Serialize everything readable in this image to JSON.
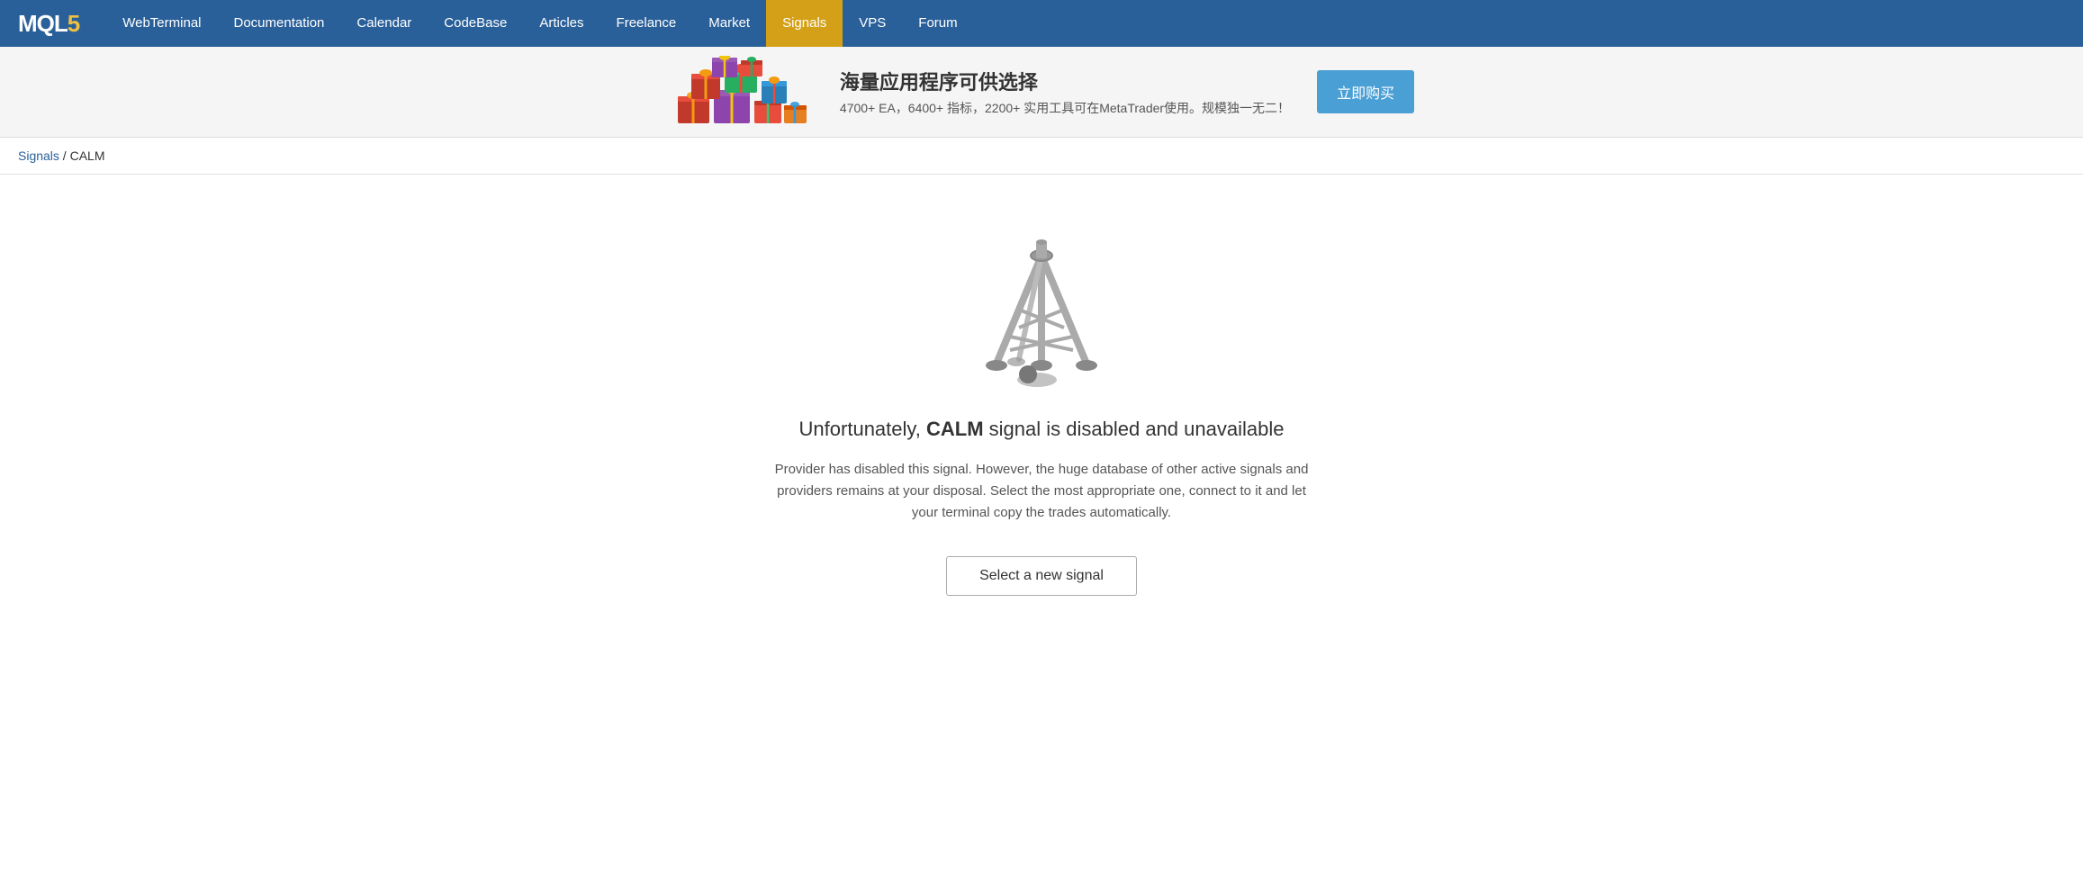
{
  "nav": {
    "logo_mql": "MQL",
    "logo_5": "5",
    "links": [
      {
        "label": "WebTerminal",
        "active": false
      },
      {
        "label": "Documentation",
        "active": false
      },
      {
        "label": "Calendar",
        "active": false
      },
      {
        "label": "CodeBase",
        "active": false
      },
      {
        "label": "Articles",
        "active": false
      },
      {
        "label": "Freelance",
        "active": false
      },
      {
        "label": "Market",
        "active": false
      },
      {
        "label": "Signals",
        "active": true
      },
      {
        "label": "VPS",
        "active": false
      },
      {
        "label": "Forum",
        "active": false
      }
    ]
  },
  "banner": {
    "headline": "海量应用程序可供选择",
    "subtext": "4700+ EA，6400+ 指标，2200+ 实用工具可在MetaTrader使用。规模独一无二！",
    "button_label": "立即购买"
  },
  "breadcrumb": {
    "signals_label": "Signals",
    "separator": " / ",
    "current": "CALM"
  },
  "main": {
    "disabled_msg_prefix": "Unfortunately, ",
    "disabled_signal_name": "CALM",
    "disabled_msg_suffix": " signal is disabled and unavailable",
    "description": "Provider has disabled this signal. However, the huge database of other active signals and providers remains at your disposal. Select the most appropriate one, connect to it and let your terminal copy the trades automatically.",
    "select_button_label": "Select a new signal"
  }
}
